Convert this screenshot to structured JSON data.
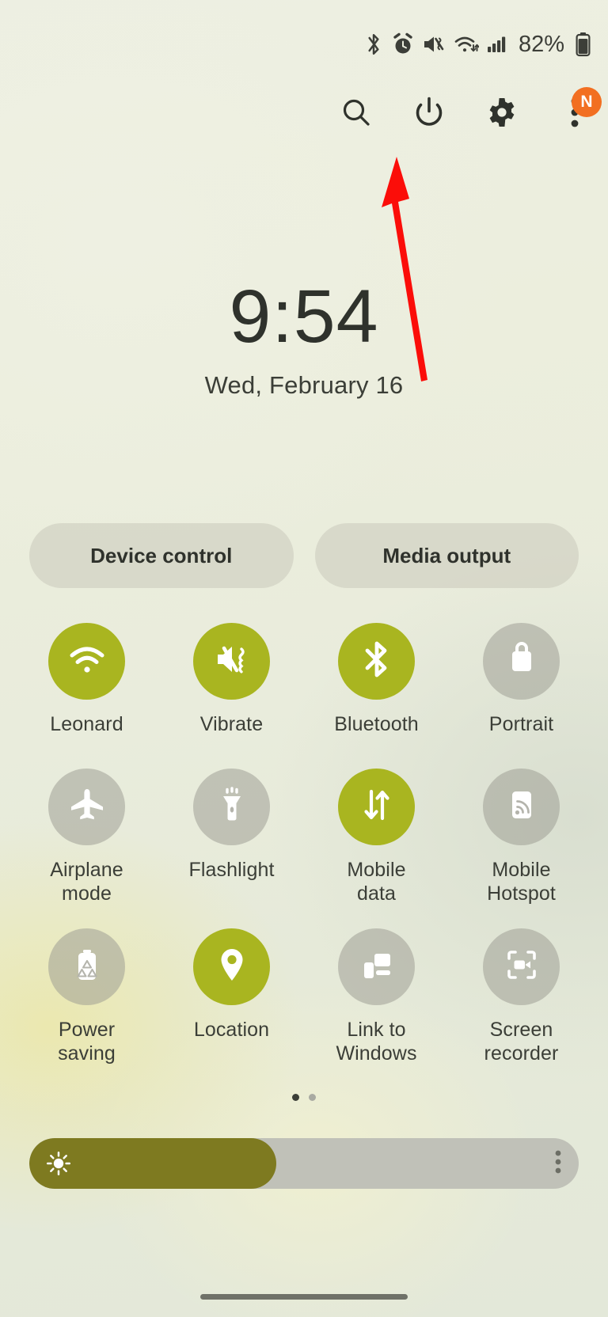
{
  "statusbar": {
    "icons": [
      "bluetooth-icon",
      "alarm-icon",
      "mute-vibrate-icon",
      "wifi-icon",
      "signal-icon"
    ],
    "battery_percent": "82%",
    "battery_icon": "battery-icon"
  },
  "toolbar": {
    "search_label": "search-icon",
    "power_label": "power-icon",
    "settings_label": "gear-icon",
    "more_label": "more-vertical-icon",
    "badge_text": "N",
    "badge_color": "#f26f21"
  },
  "clock": {
    "time": "9:54",
    "date": "Wed, February 16"
  },
  "pills": [
    {
      "label": "Device control"
    },
    {
      "label": "Media output"
    }
  ],
  "tiles": {
    "rows": [
      [
        {
          "label": "Leonard",
          "icon": "wifi-icon",
          "state": "on"
        },
        {
          "label": "Vibrate",
          "icon": "vibrate-icon",
          "state": "on"
        },
        {
          "label": "Bluetooth",
          "icon": "bluetooth-icon",
          "state": "on"
        },
        {
          "label": "Portrait",
          "icon": "rotation-lock-icon",
          "state": "off"
        }
      ],
      [
        {
          "label": "Airplane\nmode",
          "icon": "airplane-icon",
          "state": "off"
        },
        {
          "label": "Flashlight",
          "icon": "flashlight-icon",
          "state": "off"
        },
        {
          "label": "Mobile\ndata",
          "icon": "mobile-data-icon",
          "state": "on"
        },
        {
          "label": "Mobile\nHotspot",
          "icon": "hotspot-icon",
          "state": "off"
        }
      ],
      [
        {
          "label": "Power saving",
          "icon": "power-saving-icon",
          "state": "off"
        },
        {
          "label": "Location",
          "icon": "location-pin-icon",
          "state": "on"
        },
        {
          "label": "Link to\nWindows",
          "icon": "link-to-windows-icon",
          "state": "off"
        },
        {
          "label": "Screen\nrecorder",
          "icon": "screen-recorder-icon",
          "state": "off"
        }
      ]
    ],
    "on_color": "#a9b520",
    "off_color": "rgba(155,155,145,0.52)"
  },
  "pagination": {
    "total": 2,
    "active": 1
  },
  "brightness": {
    "value_percent": 45,
    "fill_color": "#7e7a20",
    "track_color": "#c0c1b8",
    "sun_icon": "brightness-sun-icon",
    "menu_icon": "more-vertical-icon"
  },
  "annotation": {
    "arrow_color": "#fb0d09",
    "points_to": "power-icon"
  },
  "navbar": {
    "handle": "gesture-handle"
  }
}
